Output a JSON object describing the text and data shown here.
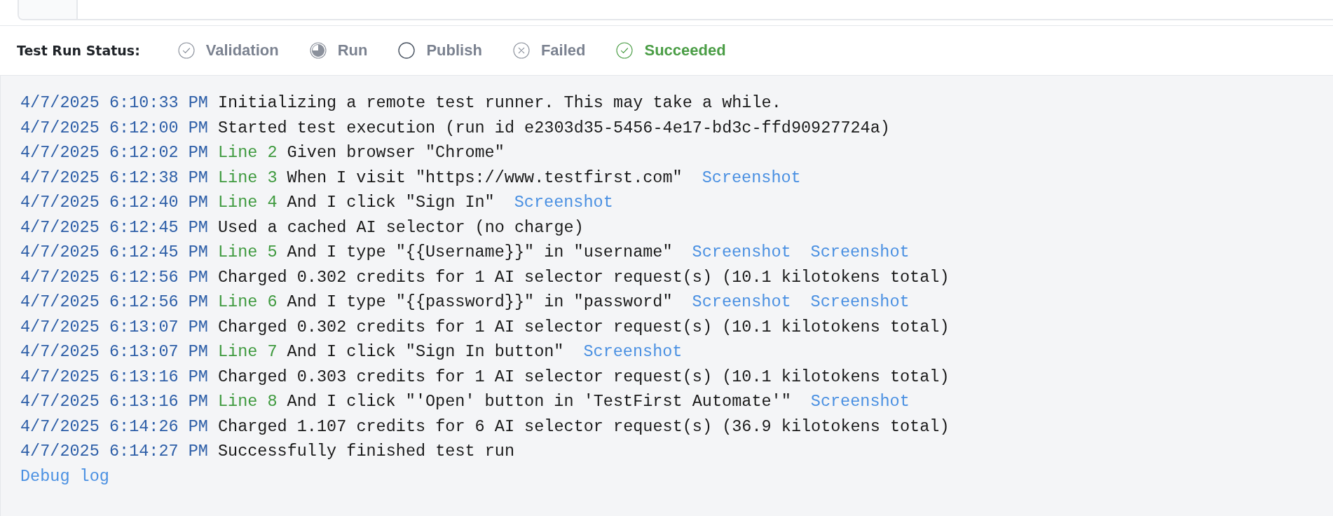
{
  "status_bar": {
    "label": "Test Run Status:",
    "steps": [
      {
        "label": "Validation",
        "kind": "done",
        "selected": false
      },
      {
        "label": "Run",
        "kind": "running",
        "selected": false
      },
      {
        "label": "Publish",
        "kind": "pending",
        "selected": false
      },
      {
        "label": "Failed",
        "kind": "failed",
        "selected": false
      },
      {
        "label": "Succeeded",
        "kind": "done",
        "selected": true
      }
    ]
  },
  "log": {
    "entries": [
      {
        "time": "4/7/2025 6:10:33 PM",
        "message": "Initializing a remote test runner. This may take a while."
      },
      {
        "time": "4/7/2025 6:12:00 PM",
        "message": "Started test execution (run id e2303d35-5456-4e17-bd3c-ffd90927724a)"
      },
      {
        "time": "4/7/2025 6:12:02 PM",
        "line": "Line 2",
        "message": "Given browser \"Chrome\""
      },
      {
        "time": "4/7/2025 6:12:38 PM",
        "line": "Line 3",
        "message": "When I visit \"https://www.testfirst.com\"",
        "links": [
          "Screenshot"
        ]
      },
      {
        "time": "4/7/2025 6:12:40 PM",
        "line": "Line 4",
        "message": "And I click \"Sign In\"",
        "links": [
          "Screenshot"
        ]
      },
      {
        "time": "4/7/2025 6:12:45 PM",
        "message": "Used a cached AI selector (no charge)"
      },
      {
        "time": "4/7/2025 6:12:45 PM",
        "line": "Line 5",
        "message": "And I type \"{{Username}}\" in \"username\"",
        "links": [
          "Screenshot",
          "Screenshot"
        ]
      },
      {
        "time": "4/7/2025 6:12:56 PM",
        "message": "Charged 0.302 credits for 1 AI selector request(s) (10.1 kilotokens total)"
      },
      {
        "time": "4/7/2025 6:12:56 PM",
        "line": "Line 6",
        "message": "And I type \"{{password}}\" in \"password\"",
        "links": [
          "Screenshot",
          "Screenshot"
        ]
      },
      {
        "time": "4/7/2025 6:13:07 PM",
        "message": "Charged 0.302 credits for 1 AI selector request(s) (10.1 kilotokens total)"
      },
      {
        "time": "4/7/2025 6:13:07 PM",
        "line": "Line 7",
        "message": "And I click \"Sign In button\"",
        "links": [
          "Screenshot"
        ]
      },
      {
        "time": "4/7/2025 6:13:16 PM",
        "message": "Charged 0.303 credits for 1 AI selector request(s) (10.1 kilotokens total)"
      },
      {
        "time": "4/7/2025 6:13:16 PM",
        "line": "Line 8",
        "message": "And I click \"'Open' button in 'TestFirst Automate'\"",
        "links": [
          "Screenshot"
        ]
      },
      {
        "time": "4/7/2025 6:14:26 PM",
        "message": "Charged 1.107 credits for 6 AI selector request(s) (36.9 kilotokens total)"
      },
      {
        "time": "4/7/2025 6:14:27 PM",
        "message": "Successfully finished test run"
      }
    ],
    "footer_link": "Debug log"
  }
}
